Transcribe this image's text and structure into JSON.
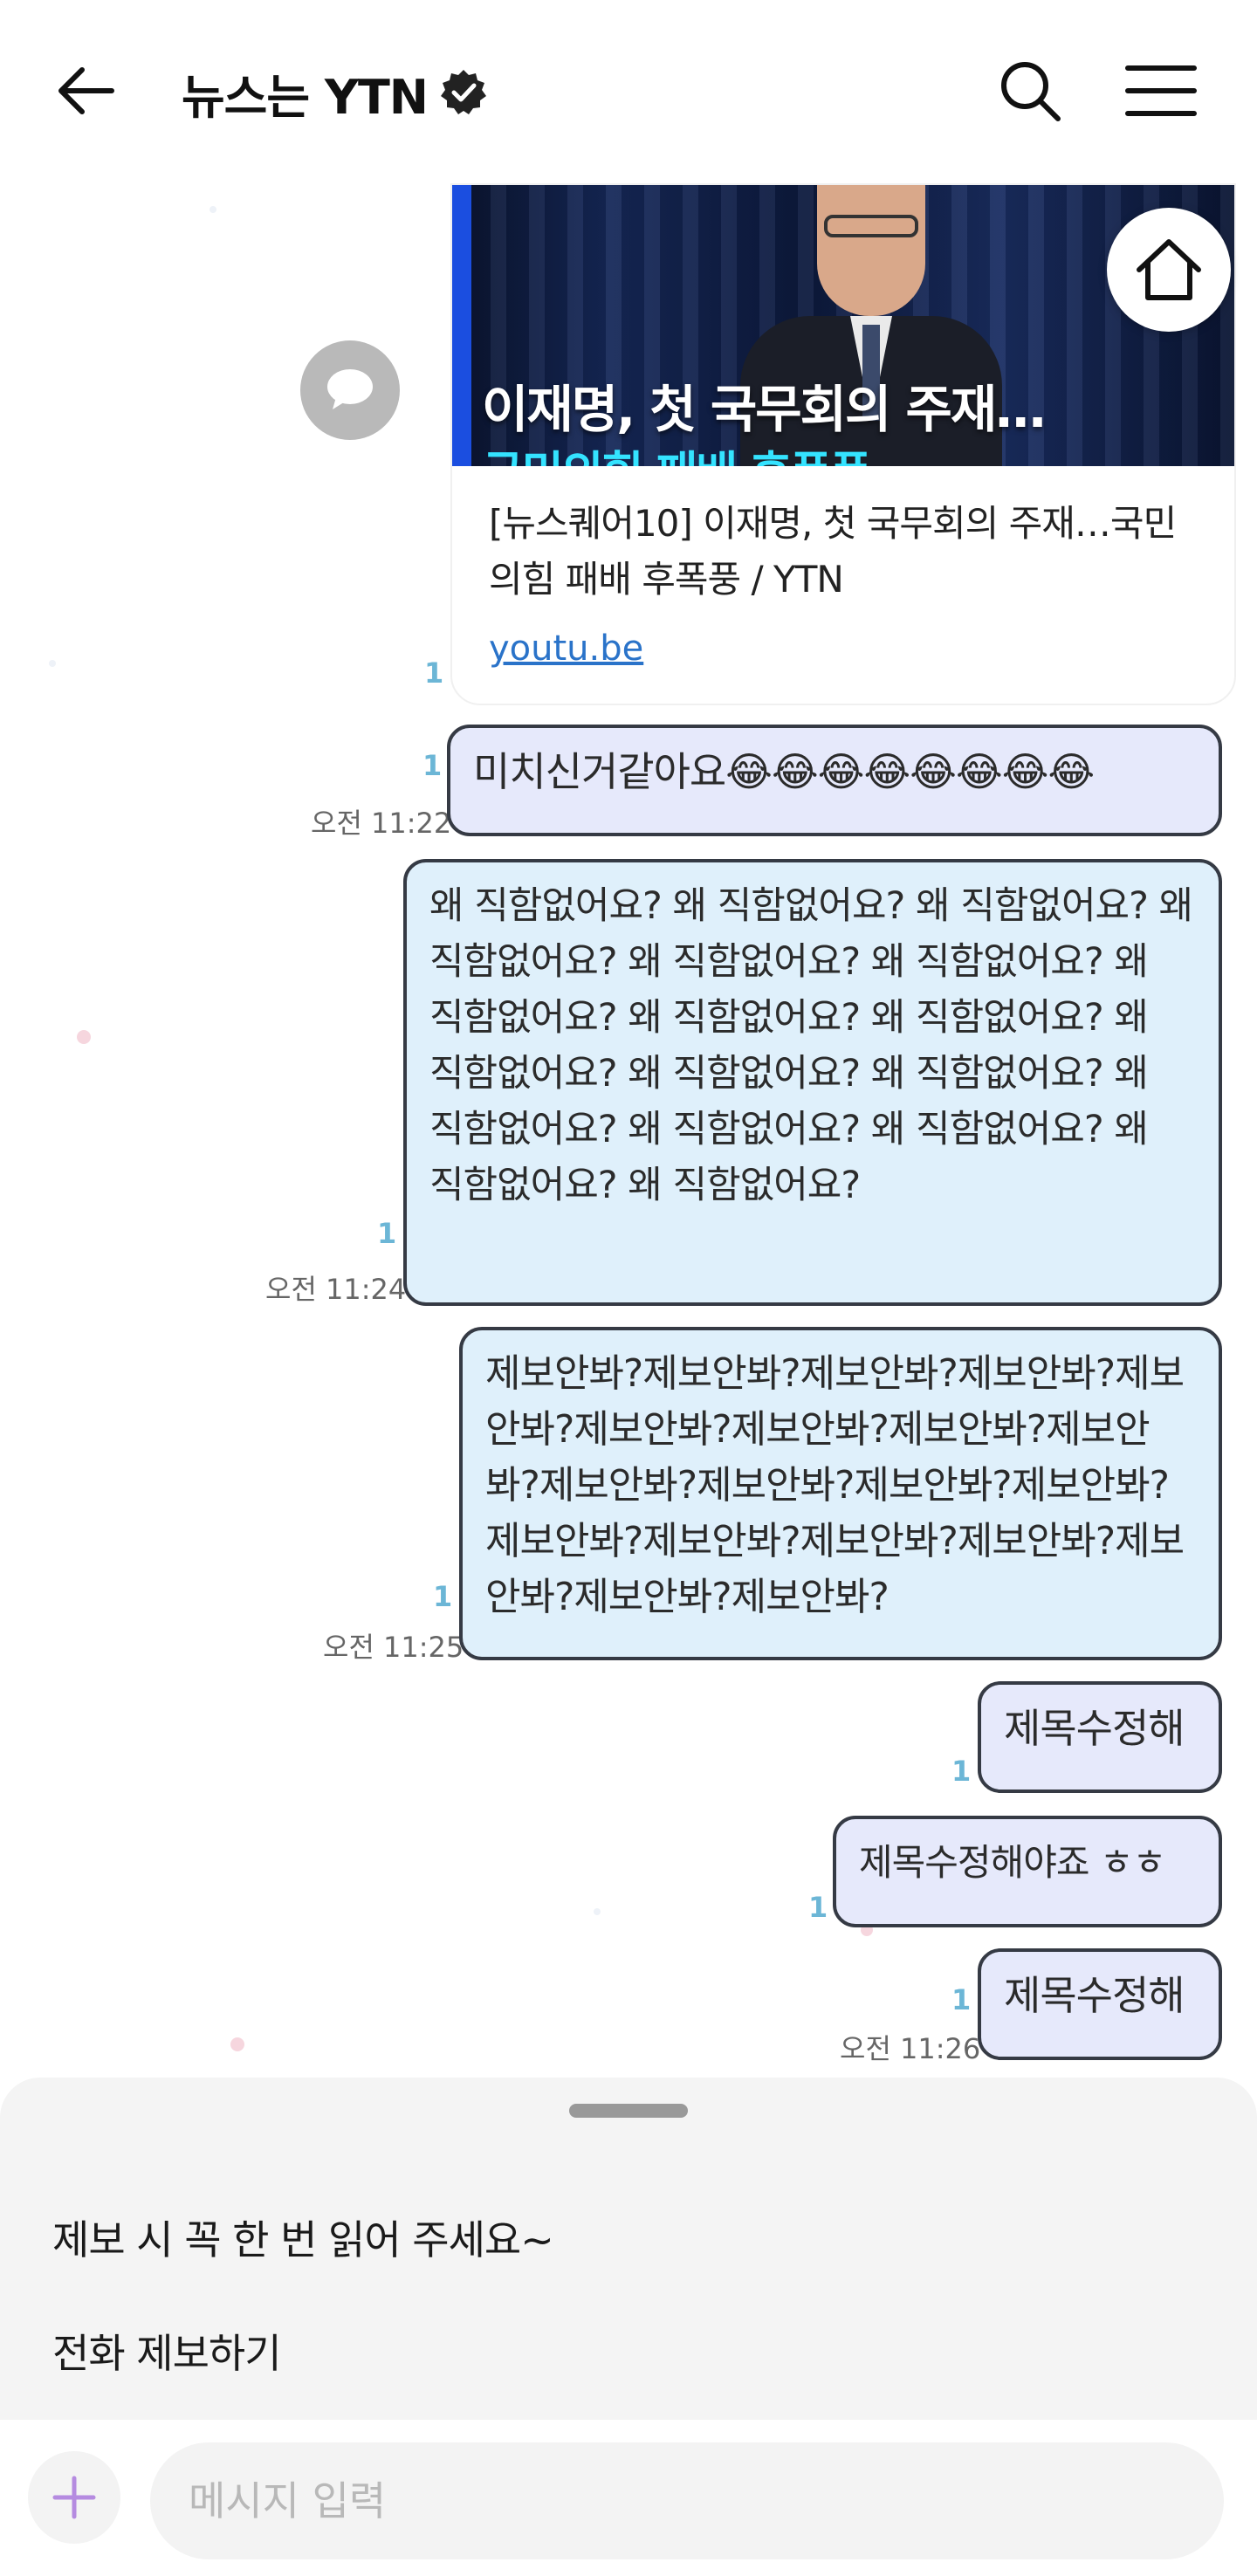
{
  "header": {
    "title": "뉴스는 YTN",
    "verified_icon": "verified-badge-icon",
    "back_icon": "arrow-left-icon",
    "search_icon": "search-icon",
    "menu_icon": "hamburger-menu-icon"
  },
  "link_card": {
    "thumbnail_headline": "이재명, 첫 국무회의 주재…",
    "thumbnail_subline": "국민의힘 패배 후폭풍",
    "title": "[뉴스퀘어10] 이재명, 첫 국무회의 주재…국민의힘 패배 후폭풍 / YTN",
    "link": "youtu.be",
    "read_count": "1"
  },
  "messages": [
    {
      "text": "미치신거같아요😂😂😂😂😂😂😂😂",
      "read_count": "1",
      "time": "오전 11:22"
    },
    {
      "text": "왜 직함없어요? 왜 직함없어요? 왜 직함없어요? 왜 직함없어요? 왜 직함없어요? 왜 직함없어요? 왜 직함없어요? 왜 직함없어요? 왜 직함없어요? 왜 직함없어요? 왜 직함없어요? 왜 직함없어요? 왜 직함없어요? 왜 직함없어요? 왜 직함없어요? 왜 직함없어요? 왜 직함없어요?",
      "read_count": "1",
      "time": "오전 11:24"
    },
    {
      "text": "제보안봐?제보안봐?제보안봐?제보안봐?제보안봐?제보안봐?제보안봐?제보안봐?제보안봐?제보안봐?제보안봐?제보안봐?제보안봐?제보안봐?제보안봐?제보안봐?제보안봐?제보안봐?제보안봐?제보안봐?",
      "read_count": "1",
      "time": "오전 11:25"
    },
    {
      "text": "제목수정해",
      "read_count": "1",
      "time": ""
    },
    {
      "text": "제목수정해야죠 ㅎㅎ",
      "read_count": "1",
      "time": ""
    },
    {
      "text": "제목수정해",
      "read_count": "1",
      "time": "오전 11:26"
    }
  ],
  "sheet": {
    "item1": "제보 시 꼭 한 번 읽어 주세요~",
    "item2": "전화 제보하기"
  },
  "input": {
    "placeholder": "메시지 입력",
    "plus_icon": "plus-icon"
  },
  "colors": {
    "bubble_border": "#353a44",
    "bubble_lavender": "#e6e9fb",
    "bubble_light_blue": "#dff0fb",
    "read_count": "#6cb6d6",
    "link": "#2a73c9",
    "plus_icon": "#b58be0"
  }
}
